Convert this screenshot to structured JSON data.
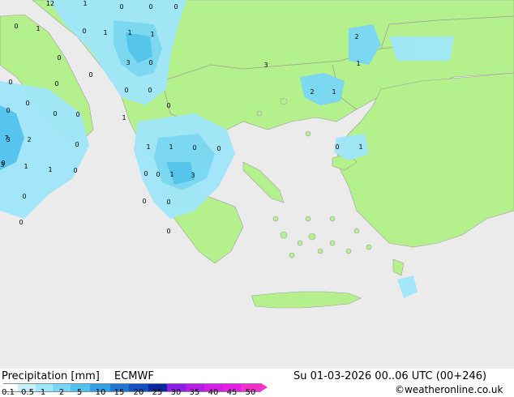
{
  "footer": {
    "title": "Precipitation [mm]",
    "model": "ECMWF",
    "valid_time": "Su 01-03-2026 00..06 UTC (00+246)",
    "credit": "©weatheronline.co.uk"
  },
  "legend": {
    "ticks": [
      "0.1",
      "0.5",
      "1",
      "2",
      "5",
      "10",
      "15",
      "20",
      "25",
      "30",
      "35",
      "40",
      "45",
      "50"
    ],
    "colors": [
      "#ffffff",
      "#c8f0fc",
      "#a0e6fa",
      "#78d7f6",
      "#50c3f0",
      "#32a0e6",
      "#1e78d2",
      "#1450be",
      "#0a28a0",
      "#8c1ee6",
      "#b41ee6",
      "#d21ee6",
      "#e61ee6",
      "#f032c8"
    ]
  },
  "map_colors": {
    "sea": "#ebebeb",
    "land": "#b4f08c",
    "border": "#a0a0a0"
  },
  "map_values": [
    {
      "t": "12"
    },
    {
      "t": "1"
    },
    {
      "t": "0"
    },
    {
      "t": "0"
    },
    {
      "t": "0"
    },
    {
      "t": "1"
    },
    {
      "t": "0"
    },
    {
      "t": "1"
    },
    {
      "t": "1"
    },
    {
      "t": "1"
    },
    {
      "t": "0"
    },
    {
      "t": "3"
    },
    {
      "t": "0"
    },
    {
      "t": "0"
    },
    {
      "t": "0"
    },
    {
      "t": "0"
    },
    {
      "t": "0"
    },
    {
      "t": "3"
    },
    {
      "t": "0"
    },
    {
      "t": "2"
    },
    {
      "t": "0"
    },
    {
      "t": "1"
    },
    {
      "t": "2"
    },
    {
      "t": "1"
    },
    {
      "t": "0"
    },
    {
      "t": "0"
    },
    {
      "t": "1"
    },
    {
      "t": "0"
    },
    {
      "t": "0"
    },
    {
      "t": "0"
    },
    {
      "t": "3"
    },
    {
      "t": "7"
    },
    {
      "t": "2"
    },
    {
      "t": "0"
    },
    {
      "t": "0"
    },
    {
      "t": "3"
    },
    {
      "t": "1"
    },
    {
      "t": "1"
    },
    {
      "t": "0"
    },
    {
      "t": "0"
    },
    {
      "t": "1"
    },
    {
      "t": "1"
    },
    {
      "t": "0"
    },
    {
      "t": "0"
    },
    {
      "t": "0"
    },
    {
      "t": "1"
    },
    {
      "t": "3"
    },
    {
      "t": "0"
    },
    {
      "t": "0"
    },
    {
      "t": "0"
    },
    {
      "t": "0"
    },
    {
      "t": "0"
    },
    {
      "t": "1"
    },
    {
      "t": "0"
    }
  ]
}
